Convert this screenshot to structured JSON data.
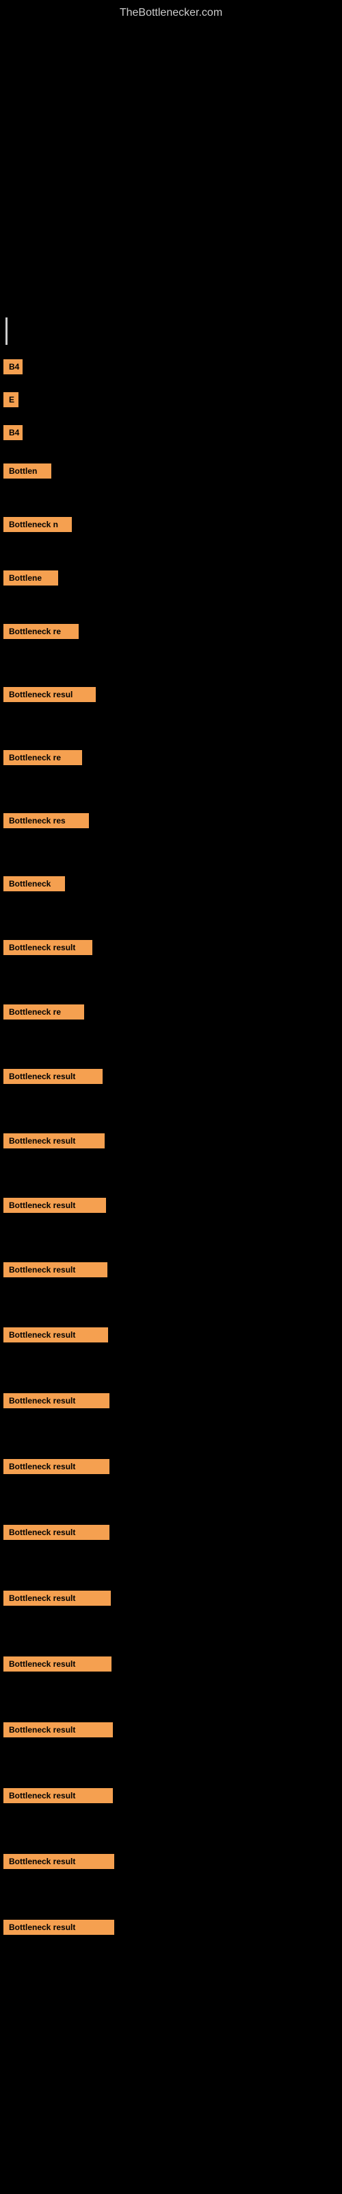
{
  "site": {
    "title": "TheBottlenecker.com"
  },
  "items": [
    {
      "id": 1,
      "label": "B4",
      "size_class": "item-1",
      "row_class": "item-row-tiny"
    },
    {
      "id": 2,
      "label": "E",
      "size_class": "item-2",
      "row_class": "item-row-tiny"
    },
    {
      "id": 3,
      "label": "B4",
      "size_class": "item-3",
      "row_class": "item-row-tiny"
    },
    {
      "id": 4,
      "label": "Bottlen",
      "size_class": "item-4",
      "row_class": "item-row-small"
    },
    {
      "id": 5,
      "label": "Bottleneck n",
      "size_class": "item-5",
      "row_class": "item-row-compact"
    },
    {
      "id": 6,
      "label": "Bottlene",
      "size_class": "item-6",
      "row_class": "item-row-small"
    },
    {
      "id": 7,
      "label": "Bottleneck re",
      "size_class": "item-7",
      "row_class": "item-row-compact"
    },
    {
      "id": 8,
      "label": "Bottleneck resul",
      "size_class": "item-8",
      "row_class": "item-row-compact"
    },
    {
      "id": 9,
      "label": "Bottleneck re",
      "size_class": "item-9",
      "row_class": "item-row-compact"
    },
    {
      "id": 10,
      "label": "Bottleneck res",
      "size_class": "item-10",
      "row_class": "item-row-compact"
    },
    {
      "id": 11,
      "label": "Bottleneck",
      "size_class": "item-11",
      "row_class": "item-row-compact"
    },
    {
      "id": 12,
      "label": "Bottleneck result",
      "size_class": "item-12",
      "row_class": "item-row-medium"
    },
    {
      "id": 13,
      "label": "Bottleneck re",
      "size_class": "item-13",
      "row_class": "item-row-medium"
    },
    {
      "id": 14,
      "label": "Bottleneck result",
      "size_class": "item-14",
      "row_class": "item-row-medium"
    },
    {
      "id": 15,
      "label": "Bottleneck result",
      "size_class": "item-15",
      "row_class": "item-row-medium"
    },
    {
      "id": 16,
      "label": "Bottleneck result",
      "size_class": "item-16",
      "row_class": "item-row-medium"
    },
    {
      "id": 17,
      "label": "Bottleneck result",
      "size_class": "item-17",
      "row_class": "item-row-medium"
    },
    {
      "id": 18,
      "label": "Bottleneck result",
      "size_class": "item-18",
      "row_class": "item-row-large"
    },
    {
      "id": 19,
      "label": "Bottleneck result",
      "size_class": "item-19",
      "row_class": "item-row-large"
    },
    {
      "id": 20,
      "label": "Bottleneck result",
      "size_class": "item-20",
      "row_class": "item-row-large"
    },
    {
      "id": 21,
      "label": "Bottleneck result",
      "size_class": "item-21",
      "row_class": "item-row-large"
    },
    {
      "id": 22,
      "label": "Bottleneck result",
      "size_class": "item-22",
      "row_class": "item-row-large"
    },
    {
      "id": 23,
      "label": "Bottleneck result",
      "size_class": "item-23",
      "row_class": "item-row-large"
    },
    {
      "id": 24,
      "label": "Bottleneck result",
      "size_class": "item-24",
      "row_class": "item-row-large"
    },
    {
      "id": 25,
      "label": "Bottleneck result",
      "size_class": "item-25",
      "row_class": "item-row-large"
    },
    {
      "id": 26,
      "label": "Bottleneck result",
      "size_class": "item-26",
      "row_class": "item-row-large"
    },
    {
      "id": 27,
      "label": "Bottleneck result",
      "size_class": "item-27",
      "row_class": "item-row-large"
    }
  ]
}
